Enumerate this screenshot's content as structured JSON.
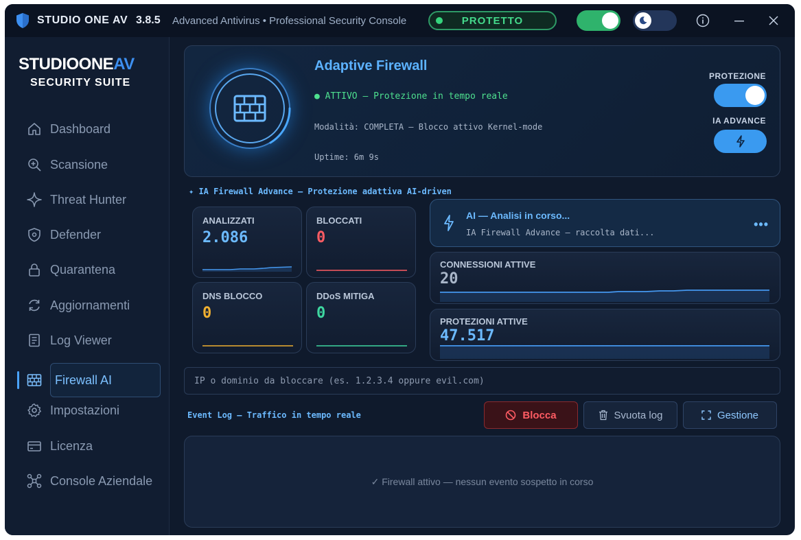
{
  "titlebar": {
    "app_name": "STUDIO ONE AV",
    "version": "3.8.5",
    "subtitle": "Advanced Antivirus  •  Professional Security Console",
    "status": "PROTETTO"
  },
  "sidebar": {
    "logo_line1_main": "STUDIOONE",
    "logo_line1_accent": "AV",
    "logo_line2": "SECURITY SUITE",
    "items": [
      {
        "label": "Dashboard",
        "icon": "home-icon"
      },
      {
        "label": "Scansione",
        "icon": "search-icon"
      },
      {
        "label": "Threat Hunter",
        "icon": "sparkle-icon"
      },
      {
        "label": "Defender",
        "icon": "shield-icon"
      },
      {
        "label": "Quarantena",
        "icon": "lock-icon"
      },
      {
        "label": "Aggiornamenti",
        "icon": "refresh-icon"
      },
      {
        "label": "Log Viewer",
        "icon": "document-icon"
      },
      {
        "label": "Firewall AI",
        "icon": "firewall-icon",
        "active": true
      },
      {
        "label": "Impostazioni",
        "icon": "gear-icon"
      },
      {
        "label": "Licenza",
        "icon": "card-icon"
      },
      {
        "label": "Console Aziendale",
        "icon": "network-icon"
      }
    ]
  },
  "hero": {
    "title": "Adaptive Firewall",
    "active_status": "● ATTIVO — Protezione in tempo reale",
    "mode": "Modalità: COMPLETA — Blocco attivo Kernel-mode",
    "uptime": "Uptime: 6m 9s",
    "protection_label": "PROTEZIONE",
    "ia_label": "IA ADVANCE"
  },
  "ia_line": "✦  IA Firewall Advance  —  Protezione adattiva AI-driven",
  "stats": {
    "analyzed": {
      "label": "ANALIZZATI",
      "value": "2.086",
      "color": "#6cbaff"
    },
    "blocked": {
      "label": "BLOCCATI",
      "value": "0",
      "color": "#ff5c63"
    },
    "dns": {
      "label": "DNS BLOCCO",
      "value": "0",
      "color": "#f0b030"
    },
    "ddos": {
      "label": "DDoS MITIGA",
      "value": "0",
      "color": "#3ed7a0"
    }
  },
  "ai_card": {
    "title": "AI — Analisi in corso...",
    "subtitle": "IA Firewall Advance — raccolta dati...",
    "dots": "•••"
  },
  "connections": {
    "label": "CONNESSIONI ATTIVE",
    "value": "20"
  },
  "protections": {
    "label": "PROTEZIONI ATTIVE",
    "value": "47.517"
  },
  "block_input": {
    "placeholder": "IP o dominio da bloccare (es. 1.2.3.4 oppure evil.com)",
    "value": ""
  },
  "event_log_label": "Event Log — Traffico in tempo reale",
  "buttons": {
    "block": "Blocca",
    "clear": "Svuota log",
    "manage": "Gestione"
  },
  "log_message": "✓  Firewall attivo — nessun evento sospetto in corso"
}
